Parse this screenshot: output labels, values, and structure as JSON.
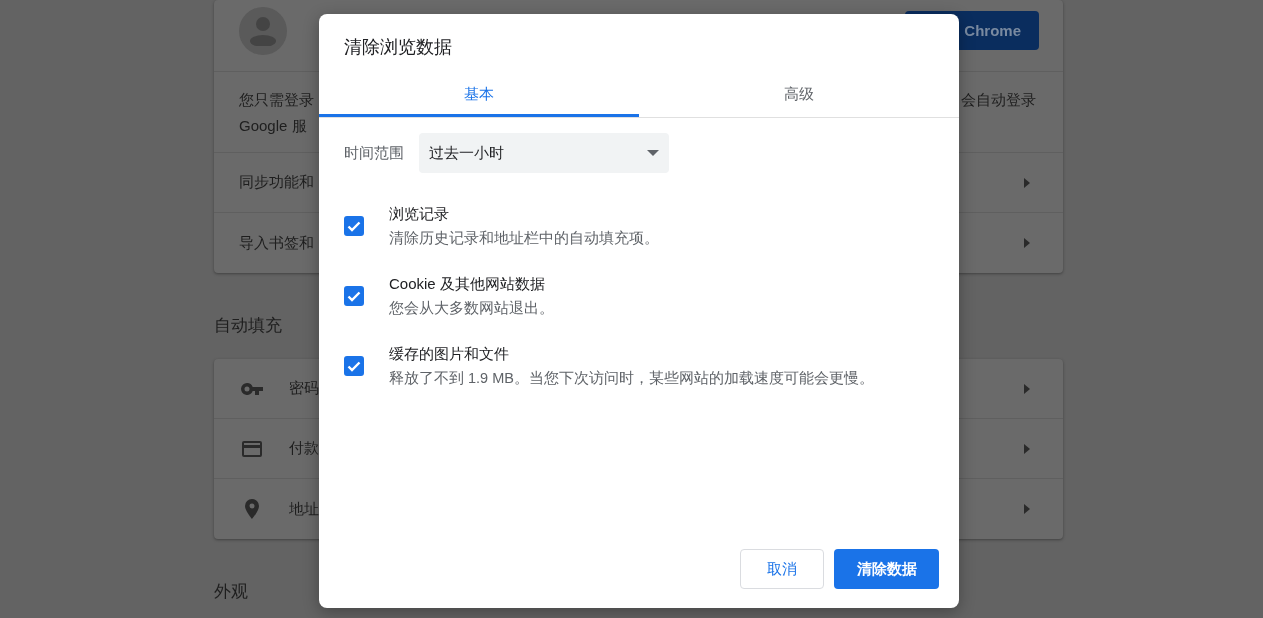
{
  "settings_page": {
    "account_row": {
      "sign_in_button": "Chrome"
    },
    "rows": [
      {
        "kind": "text",
        "lines": [
          "您只需登录",
          "Google 服"
        ],
        "trailing_text": "会自动登录"
      },
      {
        "kind": "link",
        "label": "同步功能和"
      },
      {
        "kind": "link",
        "label": "导入书签和"
      }
    ],
    "sections": [
      {
        "title": "自动填充",
        "items": [
          {
            "kind": "key",
            "label": "密码"
          },
          {
            "kind": "card",
            "label": "付款"
          },
          {
            "kind": "pin",
            "label": "地址"
          }
        ]
      },
      {
        "title": "外观"
      }
    ]
  },
  "dialog": {
    "title": "清除浏览数据",
    "tabs": [
      {
        "label": "基本",
        "selected": true
      },
      {
        "label": "高级",
        "selected": false
      }
    ],
    "time_range": {
      "label": "时间范围",
      "value": "过去一小时"
    },
    "options": [
      {
        "title": "浏览记录",
        "description": "清除历史记录和地址栏中的自动填充项。",
        "checked": true
      },
      {
        "title": "Cookie 及其他网站数据",
        "description": "您会从大多数网站退出。",
        "checked": true
      },
      {
        "title": "缓存的图片和文件",
        "description": "释放了不到 1.9 MB。当您下次访问时，某些网站的加载速度可能会更慢。",
        "checked": true
      }
    ],
    "buttons": [
      {
        "label": "取消",
        "kind": "secondary"
      },
      {
        "label": "清除数据",
        "kind": "primary"
      }
    ]
  }
}
